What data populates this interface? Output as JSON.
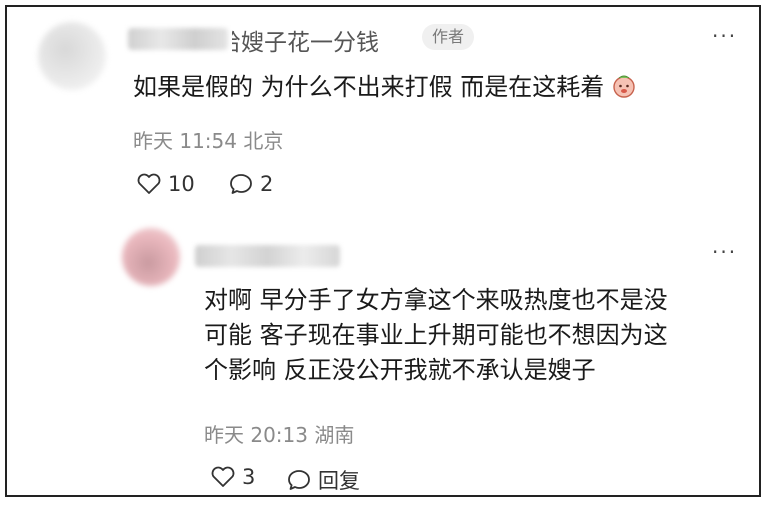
{
  "comment": {
    "author_visible": "给嫂子花一分钱",
    "author_badge": "作者",
    "more": "···",
    "text": "如果是假的 为什么不出来打假 而是在这耗着",
    "time": "昨天 11:54",
    "location": "北京",
    "likes": "10",
    "replies": "2",
    "emoji_icon": "sticker-emoji-icon"
  },
  "reply": {
    "more": "···",
    "text_line1": "对啊 早分手了女方拿这个来吸热度也不是没",
    "text_line2": "可能 客子现在事业上升期可能也不想因为这",
    "text_line3": "个影响 反正没公开我就不承认是嫂子",
    "time": "昨天 20:13",
    "location": "湖南",
    "likes": "3",
    "reply_label": "回复"
  },
  "colors": {
    "meta_gray": "#8a8a8a",
    "badge_bg": "#f0f0f0",
    "avatar_pink": "#e9b7bd"
  }
}
